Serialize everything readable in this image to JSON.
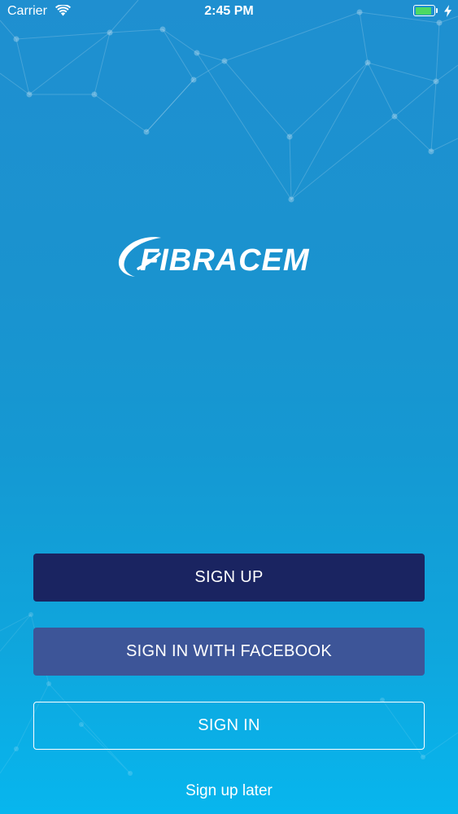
{
  "status_bar": {
    "carrier": "Carrier",
    "time": "2:45 PM",
    "battery_level_percent": 90,
    "battery_color": "#4cd964",
    "icons": [
      "wifi-icon",
      "battery-icon",
      "charging-bolt-icon"
    ]
  },
  "logo": {
    "text": "FIBRACEM",
    "icon": "fibracem-swoosh-logo"
  },
  "buttons": {
    "sign_up": "SIGN UP",
    "sign_in_facebook": "SIGN IN WITH FACEBOOK",
    "sign_in": "SIGN IN"
  },
  "links": {
    "sign_up_later": "Sign up later"
  },
  "colors": {
    "sign_up_bg": "#1a2461",
    "facebook_bg": "#3d5598",
    "background_top": "#1f8fd0",
    "background_bottom": "#07b6ee"
  }
}
